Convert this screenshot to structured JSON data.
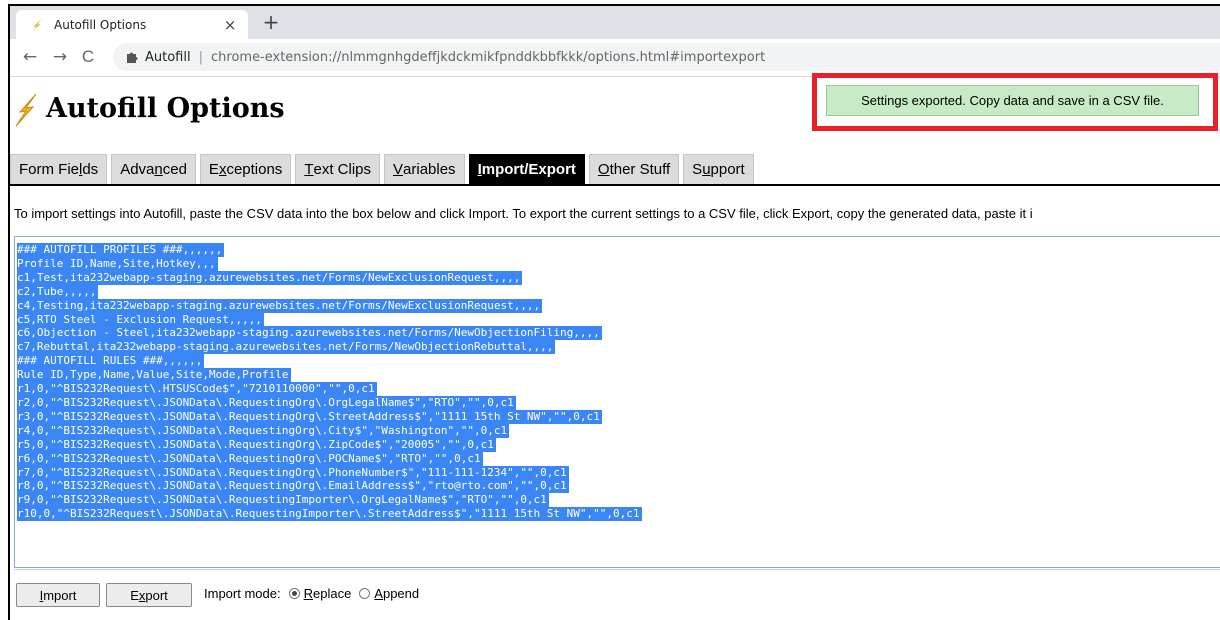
{
  "browser": {
    "tab_title": "Autofill Options",
    "tab_close": "×",
    "new_tab": "+",
    "back": "←",
    "forward": "→",
    "reload": "C",
    "site_chip": "Autofill",
    "separator": "|",
    "url": "chrome-extension://nlmmgnhgdeffjkdckmikfpnddkbbfkkk/options.html#importexport"
  },
  "page": {
    "title": "Autofill Options",
    "notice": "Settings exported. Copy data and save in a CSV file.",
    "nav_tabs": [
      {
        "pre": "Form Fie",
        "u": "l",
        "post": "ds",
        "active": false
      },
      {
        "pre": "Adva",
        "u": "n",
        "post": "ced",
        "active": false
      },
      {
        "pre": "E",
        "u": "x",
        "post": "ceptions",
        "active": false
      },
      {
        "pre": "",
        "u": "T",
        "post": "ext Clips",
        "active": false
      },
      {
        "pre": "",
        "u": "V",
        "post": "ariables",
        "active": false
      },
      {
        "pre": "",
        "u": "I",
        "post": "mport/Export",
        "active": true
      },
      {
        "pre": "",
        "u": "O",
        "post": "ther Stuff",
        "active": false
      },
      {
        "pre": "S",
        "u": "u",
        "post": "pport",
        "active": false
      }
    ],
    "instructions": "To import settings into Autofill, paste the CSV data into the box below and click Import. To export the current settings to a CSV file, click Export, copy the generated data, paste it i",
    "csv_lines": [
      "### AUTOFILL PROFILES ###,,,,,,",
      "Profile ID,Name,Site,Hotkey,,,",
      "c1,Test,ita232webapp-staging.azurewebsites.net/Forms/NewExclusionRequest,,,,",
      "c2,Tube,,,,,",
      "c4,Testing,ita232webapp-staging.azurewebsites.net/Forms/NewExclusionRequest,,,,",
      "c5,RTO Steel - Exclusion Request,,,,,",
      "c6,Objection - Steel,ita232webapp-staging.azurewebsites.net/Forms/NewObjectionFiling,,,,",
      "c7,Rebuttal,ita232webapp-staging.azurewebsites.net/Forms/NewObjectionRebuttal,,,,",
      "### AUTOFILL RULES ###,,,,,,",
      "Rule ID,Type,Name,Value,Site,Mode,Profile",
      "r1,0,\"^BIS232Request\\.HTSUSCode$\",\"7210110000\",\"\",0,c1",
      "r2,0,\"^BIS232Request\\.JSONData\\.RequestingOrg\\.OrgLegalName$\",\"RTO\",\"\",0,c1",
      "r3,0,\"^BIS232Request\\.JSONData\\.RequestingOrg\\.StreetAddress$\",\"1111 15th St NW\",\"\",0,c1",
      "r4,0,\"^BIS232Request\\.JSONData\\.RequestingOrg\\.City$\",\"Washington\",\"\",0,c1",
      "r5,0,\"^BIS232Request\\.JSONData\\.RequestingOrg\\.ZipCode$\",\"20005\",\"\",0,c1",
      "r6,0,\"^BIS232Request\\.JSONData\\.RequestingOrg\\.POCName$\",\"RTO\",\"\",0,c1",
      "r7,0,\"^BIS232Request\\.JSONData\\.RequestingOrg\\.PhoneNumber$\",\"111-111-1234\",\"\",0,c1",
      "r8,0,\"^BIS232Request\\.JSONData\\.RequestingOrg\\.EmailAddress$\",\"rto@rto.com\",\"\",0,c1",
      "r9,0,\"^BIS232Request\\.JSONData\\.RequestingImporter\\.OrgLegalName$\",\"RTO\",\"\",0,c1",
      "r10,0,\"^BIS232Request\\.JSONData\\.RequestingImporter\\.StreetAddress$\",\"1111 15th St NW\",\"\",0,c1"
    ],
    "import_button": {
      "pre": "",
      "u": "I",
      "post": "mport"
    },
    "export_button": {
      "pre": "E",
      "u": "x",
      "post": "port"
    },
    "import_mode_label": "Import mode:",
    "mode_replace": {
      "pre": "",
      "u": "R",
      "post": "eplace",
      "checked": true
    },
    "mode_append": {
      "pre": "",
      "u": "A",
      "post": "ppend",
      "checked": false
    }
  },
  "colors": {
    "notice_bg": "#c8eac6",
    "highlight_frame": "#e8202a",
    "selection": "#3a86f5",
    "active_tab": "#000000"
  }
}
